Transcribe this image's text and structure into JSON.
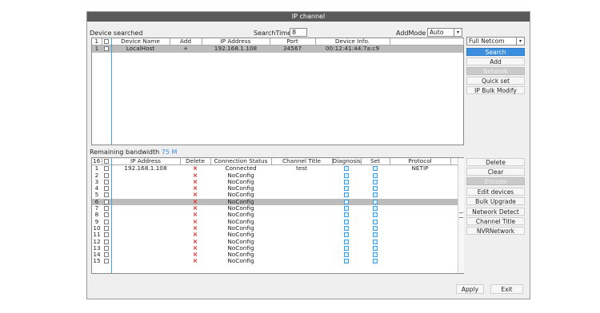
{
  "window": {
    "title": "IP channel"
  },
  "search": {
    "device_searched_label": "Device searched",
    "search_time_label": "SearchTime",
    "search_time_value": "8",
    "add_mode_label": "AddMode",
    "add_mode_value": "Auto",
    "protocol_select_value": "Full Netcom"
  },
  "device_table": {
    "headers": {
      "count": "1",
      "name": "Device Name",
      "add": "Add",
      "ip": "IP Address",
      "port": "Port",
      "info": "Device Info."
    },
    "rows": [
      {
        "num": "1",
        "name": "LocalHost",
        "add": "+",
        "ip": "192.168.1.108",
        "port": "34567",
        "info": "00:12:41:44:7a:c9"
      }
    ]
  },
  "right_buttons": {
    "search": "Search",
    "add": "Add",
    "network": "Network",
    "quick_set": "Quick set",
    "ip_bulk_modify": "IP Bulk Modify"
  },
  "bandwidth": {
    "label": "Remaining bandwidth",
    "value": "75 M"
  },
  "channel_table": {
    "headers": {
      "count": "16",
      "ip": "IP Address",
      "delete": "Delete",
      "status": "Connection Status",
      "title": "Channel Title",
      "diagnosis": "Diagnosis",
      "set": "Set",
      "protocol": "Protocol"
    },
    "rows": [
      {
        "num": "1",
        "ip": "192.168.1.108",
        "delete": "×",
        "status": "Connected",
        "title": "test",
        "protocol": "NETIP"
      },
      {
        "num": "2",
        "ip": "",
        "delete": "×",
        "status": "NoConfig",
        "title": "",
        "protocol": ""
      },
      {
        "num": "3",
        "ip": "",
        "delete": "×",
        "status": "NoConfig",
        "title": "",
        "protocol": ""
      },
      {
        "num": "4",
        "ip": "",
        "delete": "×",
        "status": "NoConfig",
        "title": "",
        "protocol": ""
      },
      {
        "num": "5",
        "ip": "",
        "delete": "×",
        "status": "NoConfig",
        "title": "",
        "protocol": ""
      },
      {
        "num": "6",
        "ip": "",
        "delete": "×",
        "status": "NoConfig",
        "title": "",
        "protocol": ""
      },
      {
        "num": "7",
        "ip": "",
        "delete": "×",
        "status": "NoConfig",
        "title": "",
        "protocol": ""
      },
      {
        "num": "8",
        "ip": "",
        "delete": "×",
        "status": "NoConfig",
        "title": "",
        "protocol": ""
      },
      {
        "num": "9",
        "ip": "",
        "delete": "×",
        "status": "NoConfig",
        "title": "",
        "protocol": ""
      },
      {
        "num": "10",
        "ip": "",
        "delete": "×",
        "status": "NoConfig",
        "title": "",
        "protocol": ""
      },
      {
        "num": "11",
        "ip": "",
        "delete": "×",
        "status": "NoConfig",
        "title": "",
        "protocol": ""
      },
      {
        "num": "12",
        "ip": "",
        "delete": "×",
        "status": "NoConfig",
        "title": "",
        "protocol": ""
      },
      {
        "num": "13",
        "ip": "",
        "delete": "×",
        "status": "NoConfig",
        "title": "",
        "protocol": ""
      },
      {
        "num": "14",
        "ip": "",
        "delete": "×",
        "status": "NoConfig",
        "title": "",
        "protocol": ""
      },
      {
        "num": "15",
        "ip": "",
        "delete": "×",
        "status": "NoConfig",
        "title": "",
        "protocol": ""
      }
    ]
  },
  "channel_buttons": {
    "delete": "Delete",
    "clear": "Clear",
    "encode": "Encode",
    "edit_devices": "Edit devices",
    "bulk_upgrade": "Bulk Upgrade",
    "network_detect": "Network Detect",
    "channel_title": "Channel Title",
    "nvr_network": "NVRNetwork"
  },
  "footer": {
    "apply": "Apply",
    "exit": "Exit"
  },
  "colors": {
    "accent": "#3c8fe0",
    "titlebar": "#5a5a5a",
    "delete": "#e02a2a",
    "highlight": "#bcbcbc"
  }
}
